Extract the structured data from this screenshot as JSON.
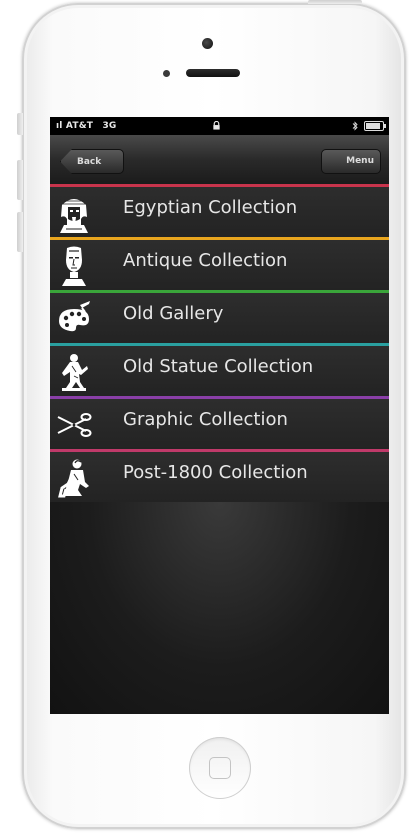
{
  "status_bar": {
    "carrier": "AT&T",
    "network": "3G"
  },
  "nav": {
    "back_label": "Back",
    "menu_label": "Menu"
  },
  "collections": [
    {
      "label": "Egyptian Collection",
      "color": "#c8344c",
      "icon": "pharaoh-icon"
    },
    {
      "label": "Antique Collection",
      "color": "#e8a51e",
      "icon": "bust-icon"
    },
    {
      "label": "Old Gallery",
      "color": "#3aa53a",
      "icon": "palette-icon"
    },
    {
      "label": "Old Statue Collection",
      "color": "#2aa0a0",
      "icon": "statue-icon"
    },
    {
      "label": "Graphic Collection",
      "color": "#8a3fa8",
      "icon": "scissors-icon"
    },
    {
      "label": "Post-1800 Collection",
      "color": "#c03a6a",
      "icon": "seated-figure-icon"
    }
  ]
}
